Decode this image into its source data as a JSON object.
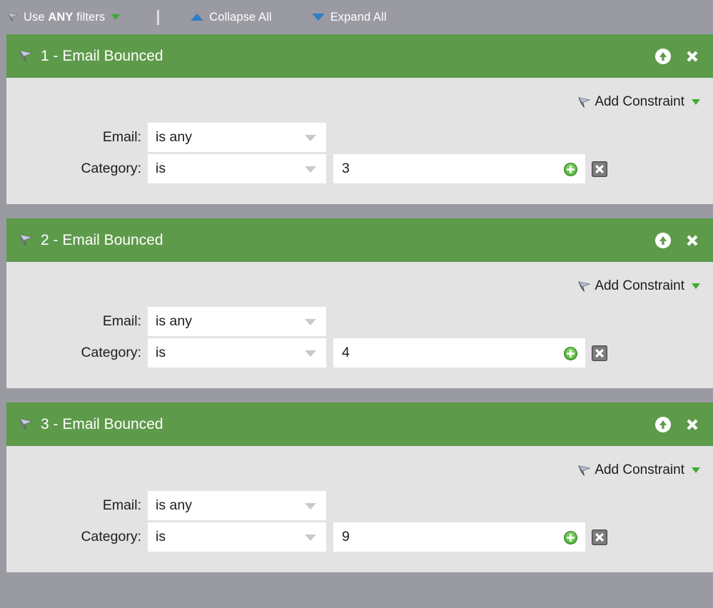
{
  "toolbar": {
    "filter_icon": "funnel-icon",
    "use_filters_prefix": "Use ",
    "use_filters_mode": "ANY",
    "use_filters_suffix": " filters",
    "mode_caret_icon": "caret-down-green-icon",
    "separator": "|",
    "collapse_all_label": "Collapse All",
    "collapse_all_icon": "triangle-up-blue-icon",
    "expand_all_label": "Expand All",
    "expand_all_icon": "triangle-down-blue-icon"
  },
  "colors": {
    "toolbar_bg": "#9a9aa2",
    "panel_header_green": "#5d9a4a",
    "panel_body_gray": "#e3e3e3",
    "accent_green_caret": "#3faa35",
    "accent_blue_triangle": "#2f7fc1",
    "field_white": "#ffffff",
    "text_dark": "#1d1d1d"
  },
  "labels": {
    "add_constraint": "Add Constraint",
    "email": "Email:",
    "category": "Category:",
    "collapse_icon_name": "collapse-panel-icon",
    "close_icon_name": "close-panel-icon",
    "add_row_icon_name": "add-row-icon",
    "delete_row_icon_name": "delete-row-icon"
  },
  "panels": [
    {
      "index": "1",
      "title": "1 - Email Bounced",
      "add_constraint_label": "Add Constraint",
      "constraints": [
        {
          "label": "Email:",
          "operator": "is any",
          "value": null,
          "has_value": false
        },
        {
          "label": "Category:",
          "operator": "is",
          "value": "3",
          "has_value": true
        }
      ]
    },
    {
      "index": "2",
      "title": "2 - Email Bounced",
      "add_constraint_label": "Add Constraint",
      "constraints": [
        {
          "label": "Email:",
          "operator": "is any",
          "value": null,
          "has_value": false
        },
        {
          "label": "Category:",
          "operator": "is",
          "value": "4",
          "has_value": true
        }
      ]
    },
    {
      "index": "3",
      "title": "3 - Email Bounced",
      "add_constraint_label": "Add Constraint",
      "constraints": [
        {
          "label": "Email:",
          "operator": "is any",
          "value": null,
          "has_value": false
        },
        {
          "label": "Category:",
          "operator": "is",
          "value": "9",
          "has_value": true
        }
      ]
    }
  ]
}
